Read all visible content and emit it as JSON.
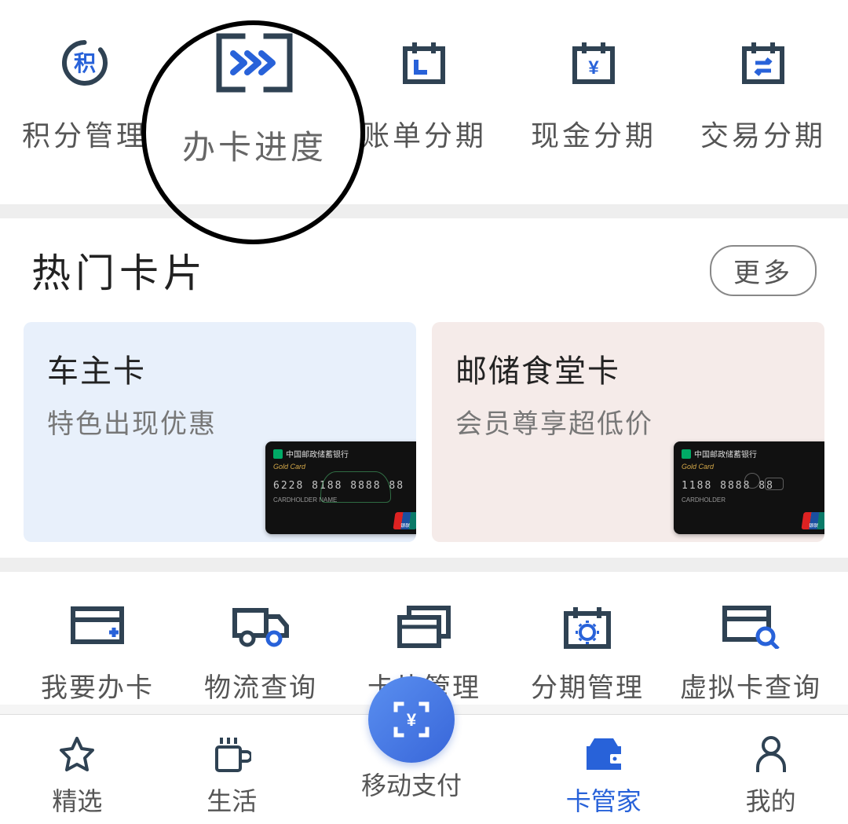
{
  "top_menu": {
    "items": [
      {
        "label": "积分管理",
        "icon_char": "积"
      },
      {
        "label": "办卡进度"
      },
      {
        "label": "账单分期"
      },
      {
        "label": "现金分期",
        "icon_char": "¥"
      },
      {
        "label": "交易分期"
      }
    ]
  },
  "hot_cards": {
    "title": "热门卡片",
    "more": "更多",
    "cards": [
      {
        "title": "车主卡",
        "subtitle": "特色出现优惠",
        "bank_name": "中国邮政储蓄银行",
        "gold_text": "Gold Card",
        "card_number": "6228 8188 8888 88",
        "holder": "CARDHOLDER NAME",
        "unionpay": "银联"
      },
      {
        "title": "邮储食堂卡",
        "subtitle": "会员尊享超低价",
        "bank_name": "中国邮政储蓄银行",
        "gold_text": "Gold Card",
        "card_number": "1188 8888 88",
        "holder": "CARDHOLDER",
        "unionpay": "银联"
      }
    ]
  },
  "actions": {
    "items": [
      {
        "label": "我要办卡"
      },
      {
        "label": "物流查询"
      },
      {
        "label": "卡片管理"
      },
      {
        "label": "分期管理"
      },
      {
        "label": "虚拟卡查询"
      }
    ]
  },
  "bottom_nav": {
    "items": [
      {
        "label": "精选"
      },
      {
        "label": "生活"
      },
      {
        "label": "移动支付"
      },
      {
        "label": "卡管家",
        "active": true
      },
      {
        "label": "我的"
      }
    ]
  }
}
